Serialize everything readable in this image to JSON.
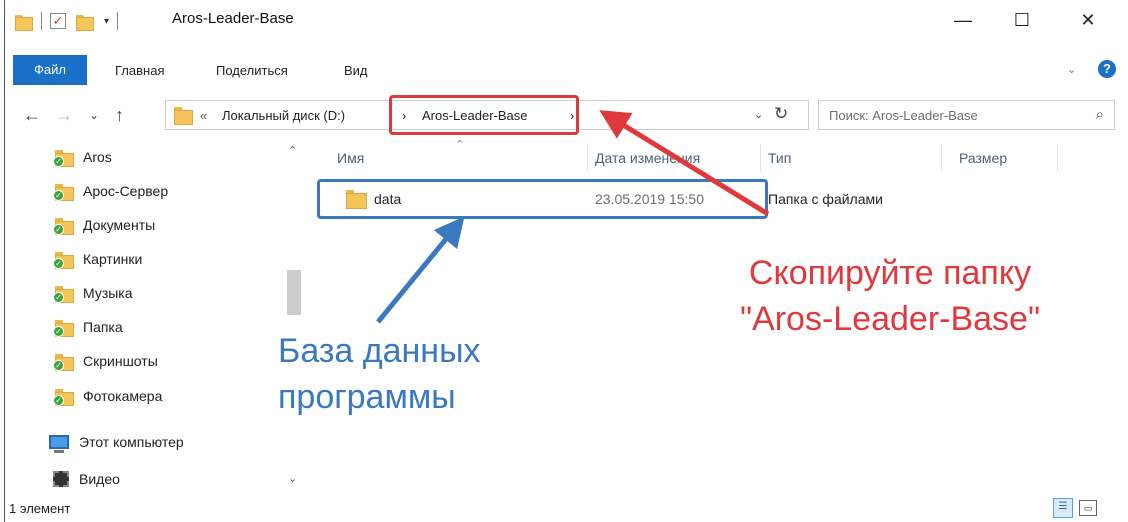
{
  "window": {
    "title": "Aros-Leader-Base",
    "controls": {
      "minimize": "—",
      "maximize": "☐",
      "close": "✕"
    },
    "quick_access": {
      "dropdown": "▾"
    }
  },
  "ribbon": {
    "file_tab": "Файл",
    "tabs": [
      "Главная",
      "Поделиться",
      "Вид"
    ],
    "expand": "⌄",
    "help": "?"
  },
  "nav": {
    "back": "←",
    "forward": "→",
    "recent": "⌄",
    "up": "↑",
    "breadcrumb": {
      "overflow": "«",
      "items": [
        "Локальный диск (D:)",
        "Aros-Leader-Base"
      ],
      "separator": "›"
    },
    "address_dropdown": "⌄",
    "refresh": "↻",
    "search_placeholder": "Поиск: Aros-Leader-Base",
    "search_icon": "⌕"
  },
  "sidebar": {
    "items": [
      {
        "label": "Aros",
        "icon": "folder-icon"
      },
      {
        "label": "Арос-Сервер",
        "icon": "folder-icon"
      },
      {
        "label": "Документы",
        "icon": "folder-icon"
      },
      {
        "label": "Картинки",
        "icon": "folder-icon"
      },
      {
        "label": "Музыка",
        "icon": "folder-icon"
      },
      {
        "label": "Папка",
        "icon": "folder-icon"
      },
      {
        "label": "Скриншоты",
        "icon": "folder-icon"
      },
      {
        "label": "Фотокамера",
        "icon": "folder-icon"
      },
      {
        "label": "Этот компьютер",
        "icon": "computer-icon"
      },
      {
        "label": "Видео",
        "icon": "video-icon"
      }
    ],
    "scroll_up": "⌃",
    "scroll_down": "⌄"
  },
  "filelist": {
    "columns": [
      "Имя",
      "Дата изменения",
      "Тип",
      "Размер"
    ],
    "sort_indicator": "⌃",
    "rows": [
      {
        "name": "data",
        "modified": "23.05.2019 15:50",
        "type": "Папка с файлами",
        "size": ""
      }
    ]
  },
  "annotations": {
    "copy_note": [
      "Скопируйте папку",
      "\"Aros-Leader-Base\""
    ],
    "db_note": [
      "База данных",
      "программы"
    ],
    "colors": {
      "red": "#e0393b",
      "blue": "#3a78c0"
    }
  },
  "status": {
    "count": "1 элемент"
  },
  "colors": {
    "accent": "#1a6fc7",
    "folder": "#f5c55a"
  }
}
